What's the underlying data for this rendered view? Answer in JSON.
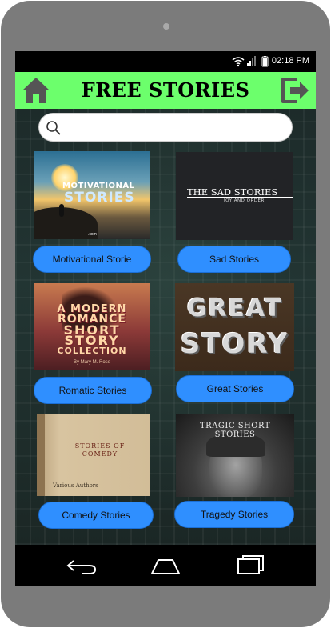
{
  "status": {
    "time": "02:18 PM"
  },
  "app": {
    "title": "FREE STORIES",
    "home_icon": "home-icon",
    "exit_icon": "exit-icon",
    "accent": "#6cff6c"
  },
  "search": {
    "placeholder": "",
    "value": ""
  },
  "stories": [
    {
      "label": "Motivational Storie",
      "cover": {
        "line1": "MOTIVATIONAL",
        "line2": "STORIES",
        "line3": ".com"
      }
    },
    {
      "label": "Sad Stories",
      "cover": {
        "title": "THE SAD STORIES",
        "subtitle": "JOY AND ORDER"
      }
    },
    {
      "label": "Romatic Stories",
      "cover": {
        "lines": [
          "A MODERN",
          "ROMANCE",
          "SHORT",
          "STORY",
          "COLLECTION"
        ],
        "author": "By Mary M. Rose"
      }
    },
    {
      "label": "Great Stories",
      "cover": {
        "line1": "GREAT",
        "line2": "STORY"
      }
    },
    {
      "label": "Comedy Stories",
      "cover": {
        "title_line1": "STORIES OF",
        "title_line2": "COMEDY",
        "author": "Various Authors"
      }
    },
    {
      "label": "Tragedy Stories",
      "cover": {
        "line1": "TRAGIC SHORT",
        "line2": "STORIES"
      }
    }
  ],
  "button_color": "#2f8fff",
  "navbar": {
    "back_icon": "back-icon",
    "home_icon": "home-nav-icon",
    "recents_icon": "recents-icon"
  }
}
